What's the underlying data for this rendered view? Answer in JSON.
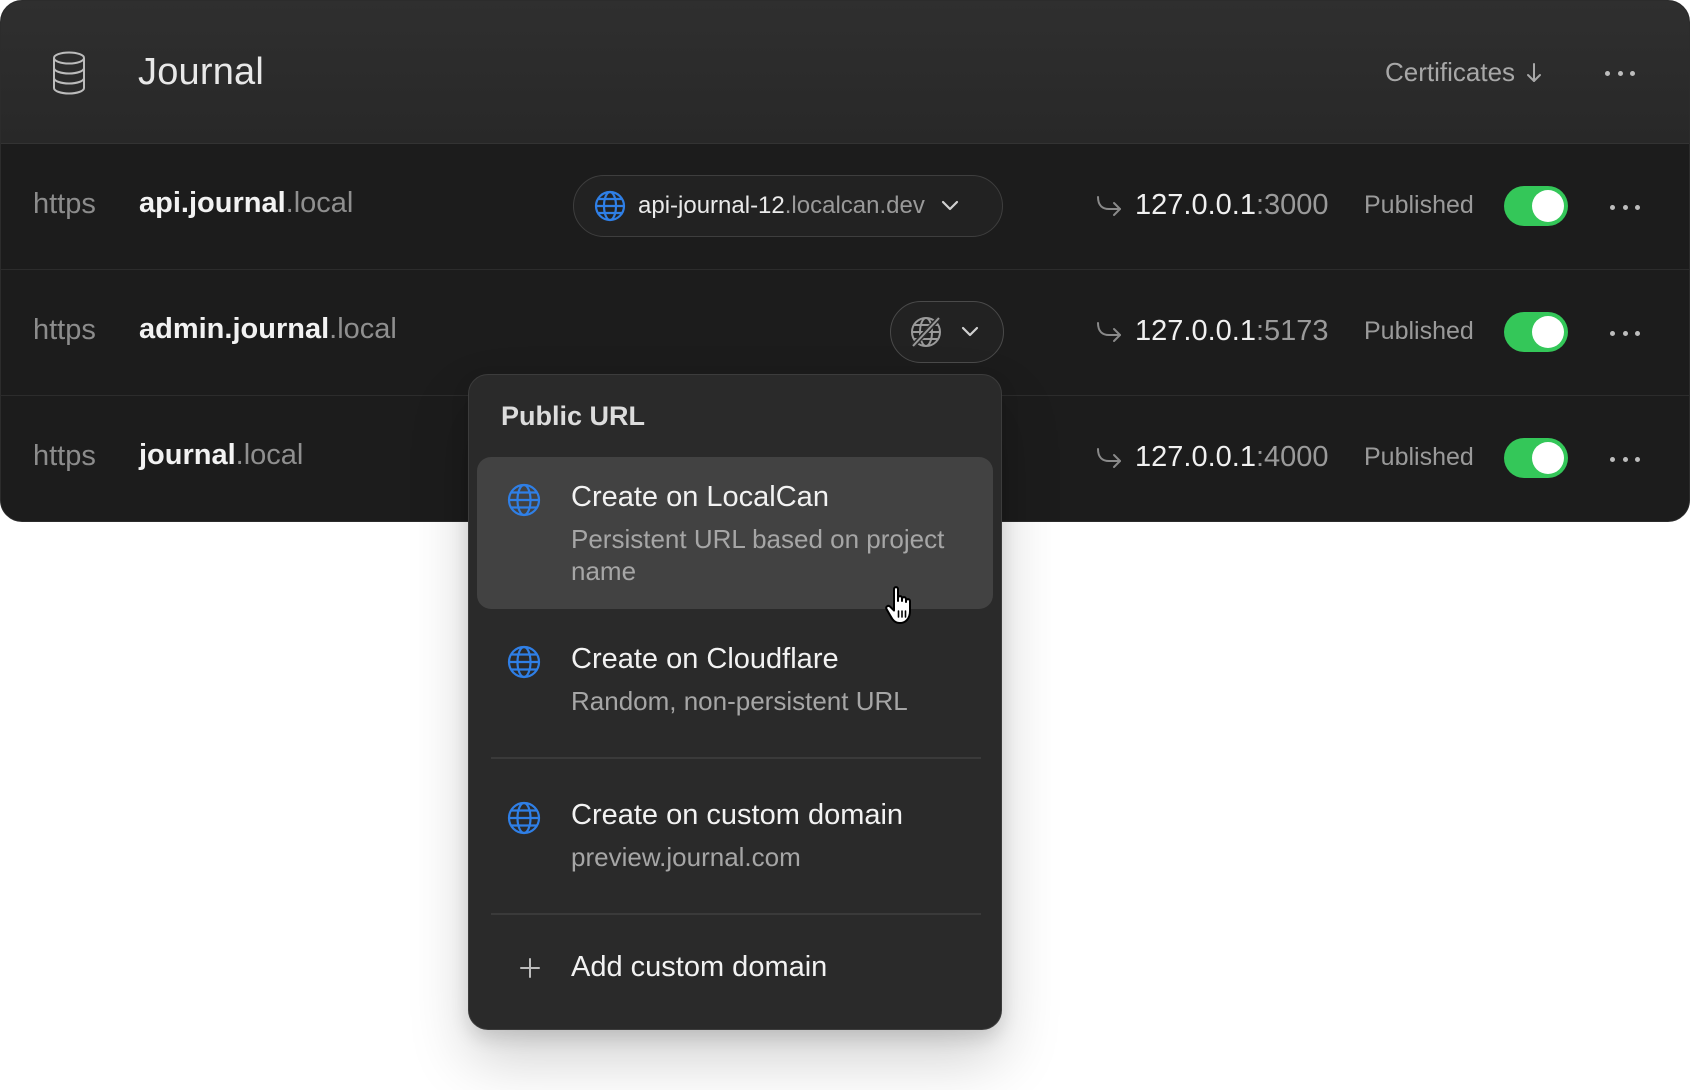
{
  "project": {
    "title": "Journal",
    "certificates_label": "Certificates",
    "icon": "database-icon"
  },
  "colors": {
    "accent_blue": "#2f7fe6",
    "toggle_green": "#34c759",
    "background": "#1c1c1c"
  },
  "rows": [
    {
      "protocol": "https",
      "subdomain": "api.journal",
      "tld": ".local",
      "public_url_host": "api-journal-12",
      "public_url_domain": ".localcan.dev",
      "target_ip": "127.0.0.1",
      "target_port": ":3000",
      "status": "Published",
      "published": true
    },
    {
      "protocol": "https",
      "subdomain": "admin.journal",
      "tld": ".local",
      "public_url_icon": "no-public-url-icon",
      "target_ip": "127.0.0.1",
      "target_port": ":5173",
      "status": "Published",
      "published": true
    },
    {
      "protocol": "https",
      "subdomain": "journal",
      "tld": ".local",
      "target_ip": "127.0.0.1",
      "target_port": ":4000",
      "status": "Published",
      "published": true
    }
  ],
  "dropdown": {
    "title": "Public URL",
    "items": [
      {
        "label": "Create on LocalCan",
        "description": "Persistent URL based on project name",
        "icon": "globe-icon",
        "hovered": true
      },
      {
        "label": "Create on Cloudflare",
        "description": "Random, non-persistent URL",
        "icon": "globe-icon"
      },
      {
        "label": "Create on custom domain",
        "description": "preview.journal.com",
        "icon": "globe-icon"
      }
    ],
    "add_label": "Add custom domain",
    "add_icon": "plus-icon"
  }
}
